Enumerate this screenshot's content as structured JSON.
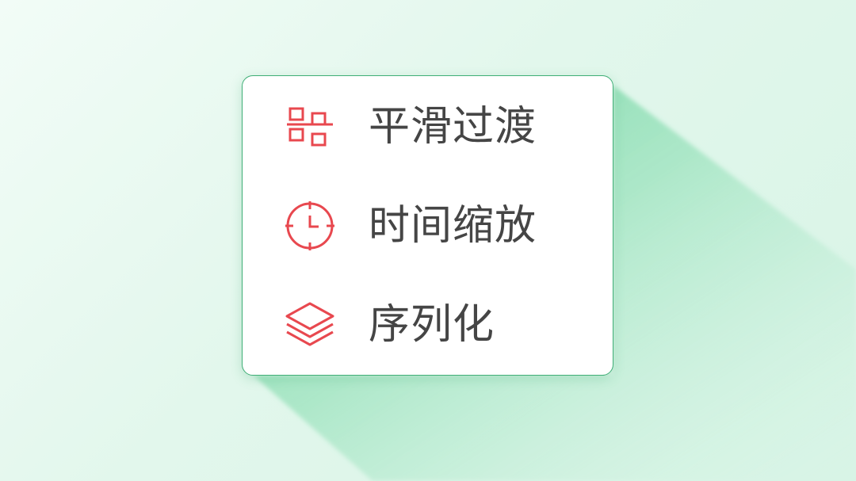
{
  "menu": {
    "items": [
      {
        "label": "平滑过渡",
        "icon": "align-split-icon"
      },
      {
        "label": "时间缩放",
        "icon": "clock-target-icon"
      },
      {
        "label": "序列化",
        "icon": "layers-icon"
      }
    ]
  },
  "colors": {
    "accent": "#e8484f",
    "border": "#3fae76",
    "text": "#454545",
    "background": "#e4f8ee"
  }
}
